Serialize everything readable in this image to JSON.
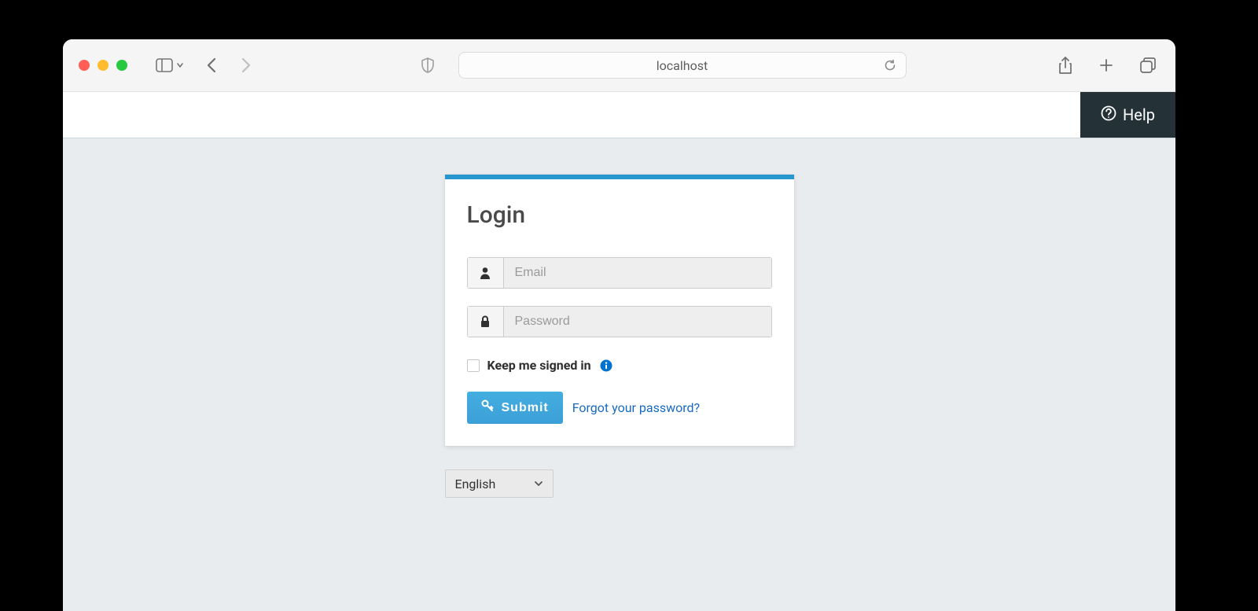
{
  "browser": {
    "url_text": "localhost"
  },
  "header": {
    "help_label": "Help"
  },
  "login": {
    "title": "Login",
    "email_placeholder": "Email",
    "email_value": "",
    "password_placeholder": "Password",
    "password_value": "",
    "keep_signed_label": "Keep me signed in",
    "keep_signed_checked": false,
    "submit_label": "Submit",
    "forgot_label": "Forgot your password?"
  },
  "language": {
    "selected": "English"
  }
}
